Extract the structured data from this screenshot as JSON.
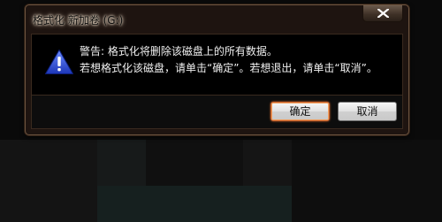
{
  "window": {
    "title": "格式化 新加卷 (G:)"
  },
  "icons": {
    "warning": "warning-icon",
    "close": "close-icon"
  },
  "message": {
    "line1": "警告: 格式化将删除该磁盘上的所有数据。",
    "line2": "若想格式化该磁盘，请单击“确定”。若想退出，请单击“取消”。"
  },
  "buttons": {
    "ok": "确定",
    "cancel": "取消"
  },
  "colors": {
    "accent": "#c8602a",
    "warning_icon": "#2a4fd0"
  }
}
